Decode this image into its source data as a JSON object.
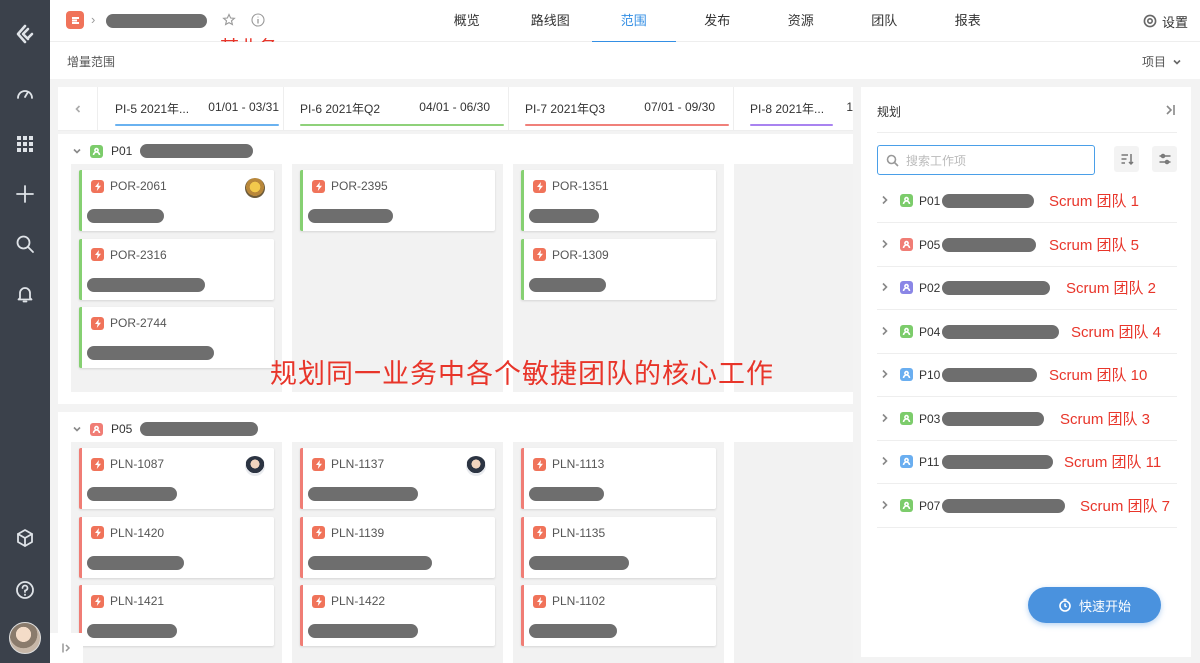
{
  "header": {
    "business_annotation": "某业务",
    "nav": [
      "概览",
      "路线图",
      "范围",
      "发布",
      "资源",
      "团队",
      "报表"
    ],
    "active_nav": "范围",
    "settings_label": "设置"
  },
  "subheader": {
    "title": "增量范围",
    "view_label": "项目"
  },
  "pi_bar": [
    {
      "name": "PI-5 2021年...",
      "dates": "01/01 - 03/31",
      "color": "#6ab2f0"
    },
    {
      "name": "PI-6 2021年Q2",
      "dates": "04/01 - 06/30",
      "color": "#8fd17a"
    },
    {
      "name": "PI-7 2021年Q3",
      "dates": "07/01 - 09/30",
      "color": "#f0807a"
    },
    {
      "name": "PI-8 2021年...",
      "dates": "1",
      "color": "#a983f0"
    }
  ],
  "groups": [
    {
      "code": "P01",
      "icon_color": "#7ccc6b",
      "columns": [
        [
          {
            "id": "POR-2061",
            "avatar": true
          },
          {
            "id": "POR-2316",
            "avatar": false
          },
          {
            "id": "POR-2744",
            "avatar": false
          }
        ],
        [
          {
            "id": "POR-2395",
            "avatar": false
          }
        ],
        [
          {
            "id": "POR-1351",
            "avatar": false
          },
          {
            "id": "POR-1309",
            "avatar": false
          }
        ]
      ],
      "card_color": "#86d072"
    },
    {
      "code": "P05",
      "icon_color": "#f07d75",
      "columns": [
        [
          {
            "id": "PLN-1087",
            "avatar": true
          },
          {
            "id": "PLN-1420",
            "avatar": false
          },
          {
            "id": "PLN-1421",
            "avatar": false
          }
        ],
        [
          {
            "id": "PLN-1137",
            "avatar": true
          },
          {
            "id": "PLN-1139",
            "avatar": false
          },
          {
            "id": "PLN-1422",
            "avatar": false
          }
        ],
        [
          {
            "id": "PLN-1113",
            "avatar": false
          },
          {
            "id": "PLN-1135",
            "avatar": false
          },
          {
            "id": "PLN-1102",
            "avatar": false
          }
        ]
      ],
      "card_color": "#f07d75"
    }
  ],
  "center_annotation": "规划同一业务中各个敏捷团队的核心工作",
  "panel": {
    "title": "规划",
    "search_placeholder": "搜索工作项",
    "teams": [
      {
        "code": "P01",
        "color": "#7ccc6b",
        "scrum": "Scrum 团队 1"
      },
      {
        "code": "P05",
        "color": "#f07d75",
        "scrum": "Scrum 团队 5"
      },
      {
        "code": "P02",
        "color": "#8a86e6",
        "scrum": "Scrum 团队 2"
      },
      {
        "code": "P04",
        "color": "#7ccc6b",
        "scrum": "Scrum 团队 4"
      },
      {
        "code": "P10",
        "color": "#6aaef0",
        "scrum": "Scrum 团队 10"
      },
      {
        "code": "P03",
        "color": "#7ccc6b",
        "scrum": "Scrum 团队 3"
      },
      {
        "code": "P11",
        "color": "#6aaef0",
        "scrum": "Scrum 团队 11"
      },
      {
        "code": "P07",
        "color": "#7ccc6b",
        "scrum": "Scrum 团队 7"
      }
    ],
    "quick_start_label": "快速开始"
  },
  "colors": {
    "accent": "#348fe4",
    "rail": "#3b414b",
    "annotation": "#e8352a"
  }
}
